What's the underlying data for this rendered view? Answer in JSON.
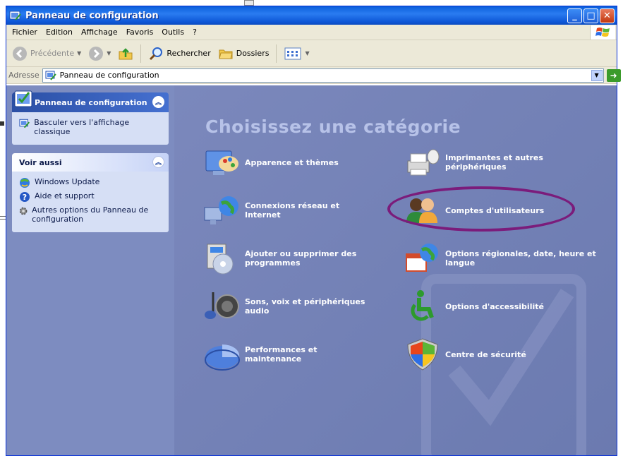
{
  "window": {
    "title": "Panneau de configuration"
  },
  "menu": [
    "Fichier",
    "Edition",
    "Affichage",
    "Favoris",
    "Outils",
    "?"
  ],
  "toolbar": {
    "back": "Précédente",
    "search": "Rechercher",
    "folders": "Dossiers"
  },
  "address": {
    "label": "Adresse",
    "value": "Panneau de configuration",
    "go": "OK"
  },
  "left": {
    "panel_title": "Panneau de configuration",
    "switch_link": "Basculer vers l'affichage classique",
    "see_also_title": "Voir aussi",
    "see_also": [
      "Windows Update",
      "Aide et support",
      "Autres options du Panneau de configuration"
    ]
  },
  "main": {
    "heading": "Choisissez une catégorie",
    "categories": [
      "Apparence et thèmes",
      "Imprimantes et autres périphériques",
      "Connexions réseau et Internet",
      "Comptes d'utilisateurs",
      "Ajouter ou supprimer des programmes",
      "Options régionales, date, heure et langue",
      "Sons, voix et périphériques audio",
      "Options d'accessibilité",
      "Performances et maintenance",
      "Centre de sécurité"
    ]
  },
  "colors": {
    "title_blue": "#0a5eda",
    "content_bg": "#6f7eb0",
    "highlight_oval": "#7b1c7b"
  }
}
